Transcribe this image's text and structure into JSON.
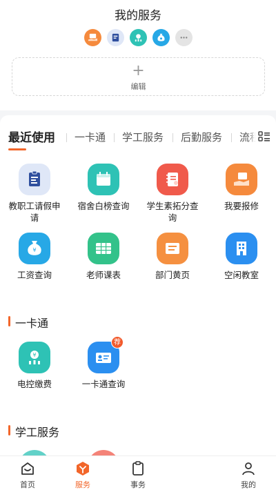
{
  "header": {
    "title": "我的服务",
    "edit_plus": "+",
    "edit_label": "编辑"
  },
  "my_services_icons": [
    "hand-card-icon",
    "calendar-card-icon",
    "chart-coin-icon",
    "money-bag-icon",
    "more-icon"
  ],
  "tabs": [
    {
      "label": "最近使用",
      "active": true
    },
    {
      "label": "一卡通",
      "active": false
    },
    {
      "label": "学工服务",
      "active": false
    },
    {
      "label": "后勤服务",
      "active": false
    },
    {
      "label": "流程",
      "active": false
    }
  ],
  "recent": [
    {
      "label": "教职工请假申请",
      "icon": "leave-form-icon",
      "color": "#dfe7f7"
    },
    {
      "label": "宿舍白榜查询",
      "icon": "calendar-icon",
      "color": "#2ec2b5"
    },
    {
      "label": "学生素拓分查询",
      "icon": "notebook-icon",
      "color": "#f05a4b"
    },
    {
      "label": "我要报修",
      "icon": "hand-repair-icon",
      "color": "#f58a3d"
    },
    {
      "label": "工资查询",
      "icon": "money-bag-icon",
      "color": "#27a8e6"
    },
    {
      "label": "老师课表",
      "icon": "timetable-icon",
      "color": "#33c28a"
    },
    {
      "label": "部门黄页",
      "icon": "yellow-pages-icon",
      "color": "#f59040"
    },
    {
      "label": "空闲教室",
      "icon": "building-icon",
      "color": "#2b8ff0"
    }
  ],
  "section_card": {
    "title": "一卡通",
    "items": [
      {
        "label": "电控缴费",
        "icon": "power-coin-icon",
        "color": "#2ec2b5"
      },
      {
        "label": "一卡通查询",
        "icon": "id-card-icon",
        "color": "#2b8ff0",
        "badge": "荐"
      }
    ]
  },
  "section_student": {
    "title": "学工服务"
  },
  "bottom_nav": [
    {
      "label": "首页",
      "icon": "home-icon",
      "active": false
    },
    {
      "label": "服务",
      "icon": "service-cube-icon",
      "active": true
    },
    {
      "label": "事务",
      "icon": "task-icon",
      "active": false
    },
    {
      "label": "我的",
      "icon": "user-icon",
      "active": false
    }
  ],
  "colors": {
    "accent": "#f2662a"
  }
}
